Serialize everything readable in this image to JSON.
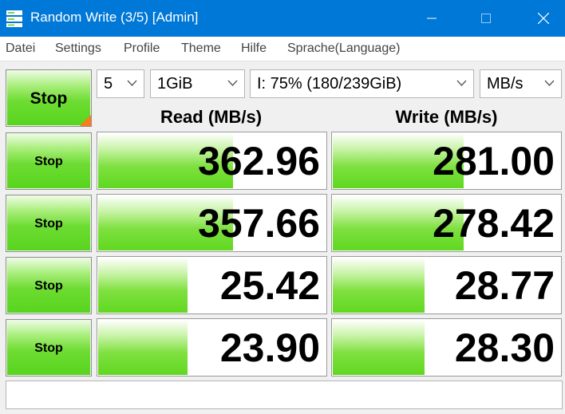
{
  "window": {
    "title": "Random Write (3/5) [Admin]",
    "accent_color": "#0078d7",
    "icons": {
      "app": "disk-icon",
      "minimize": "minimize-icon",
      "maximize": "maximize-icon",
      "close": "close-icon"
    }
  },
  "menu": [
    "Datei",
    "Settings",
    "Profile",
    "Theme",
    "Hilfe",
    "Sprache(Language)"
  ],
  "controls": {
    "main_stop_label": "Stop",
    "count": "5",
    "size": "1GiB",
    "drive": "I: 75% (180/239GiB)",
    "unit": "MB/s"
  },
  "headers": {
    "read": "Read (MB/s)",
    "write": "Write (MB/s)"
  },
  "rows": [
    {
      "stop_label": "Stop",
      "read": "362.96",
      "read_fill": 0.59,
      "write": "281.00",
      "write_fill": 0.57
    },
    {
      "stop_label": "Stop",
      "read": "357.66",
      "read_fill": 0.59,
      "write": "278.42",
      "write_fill": 0.57
    },
    {
      "stop_label": "Stop",
      "read": "25.42",
      "read_fill": 0.39,
      "write": "28.77",
      "write_fill": 0.4
    },
    {
      "stop_label": "Stop",
      "read": "23.90",
      "read_fill": 0.39,
      "write": "28.30",
      "write_fill": 0.4
    }
  ],
  "status_text": ""
}
